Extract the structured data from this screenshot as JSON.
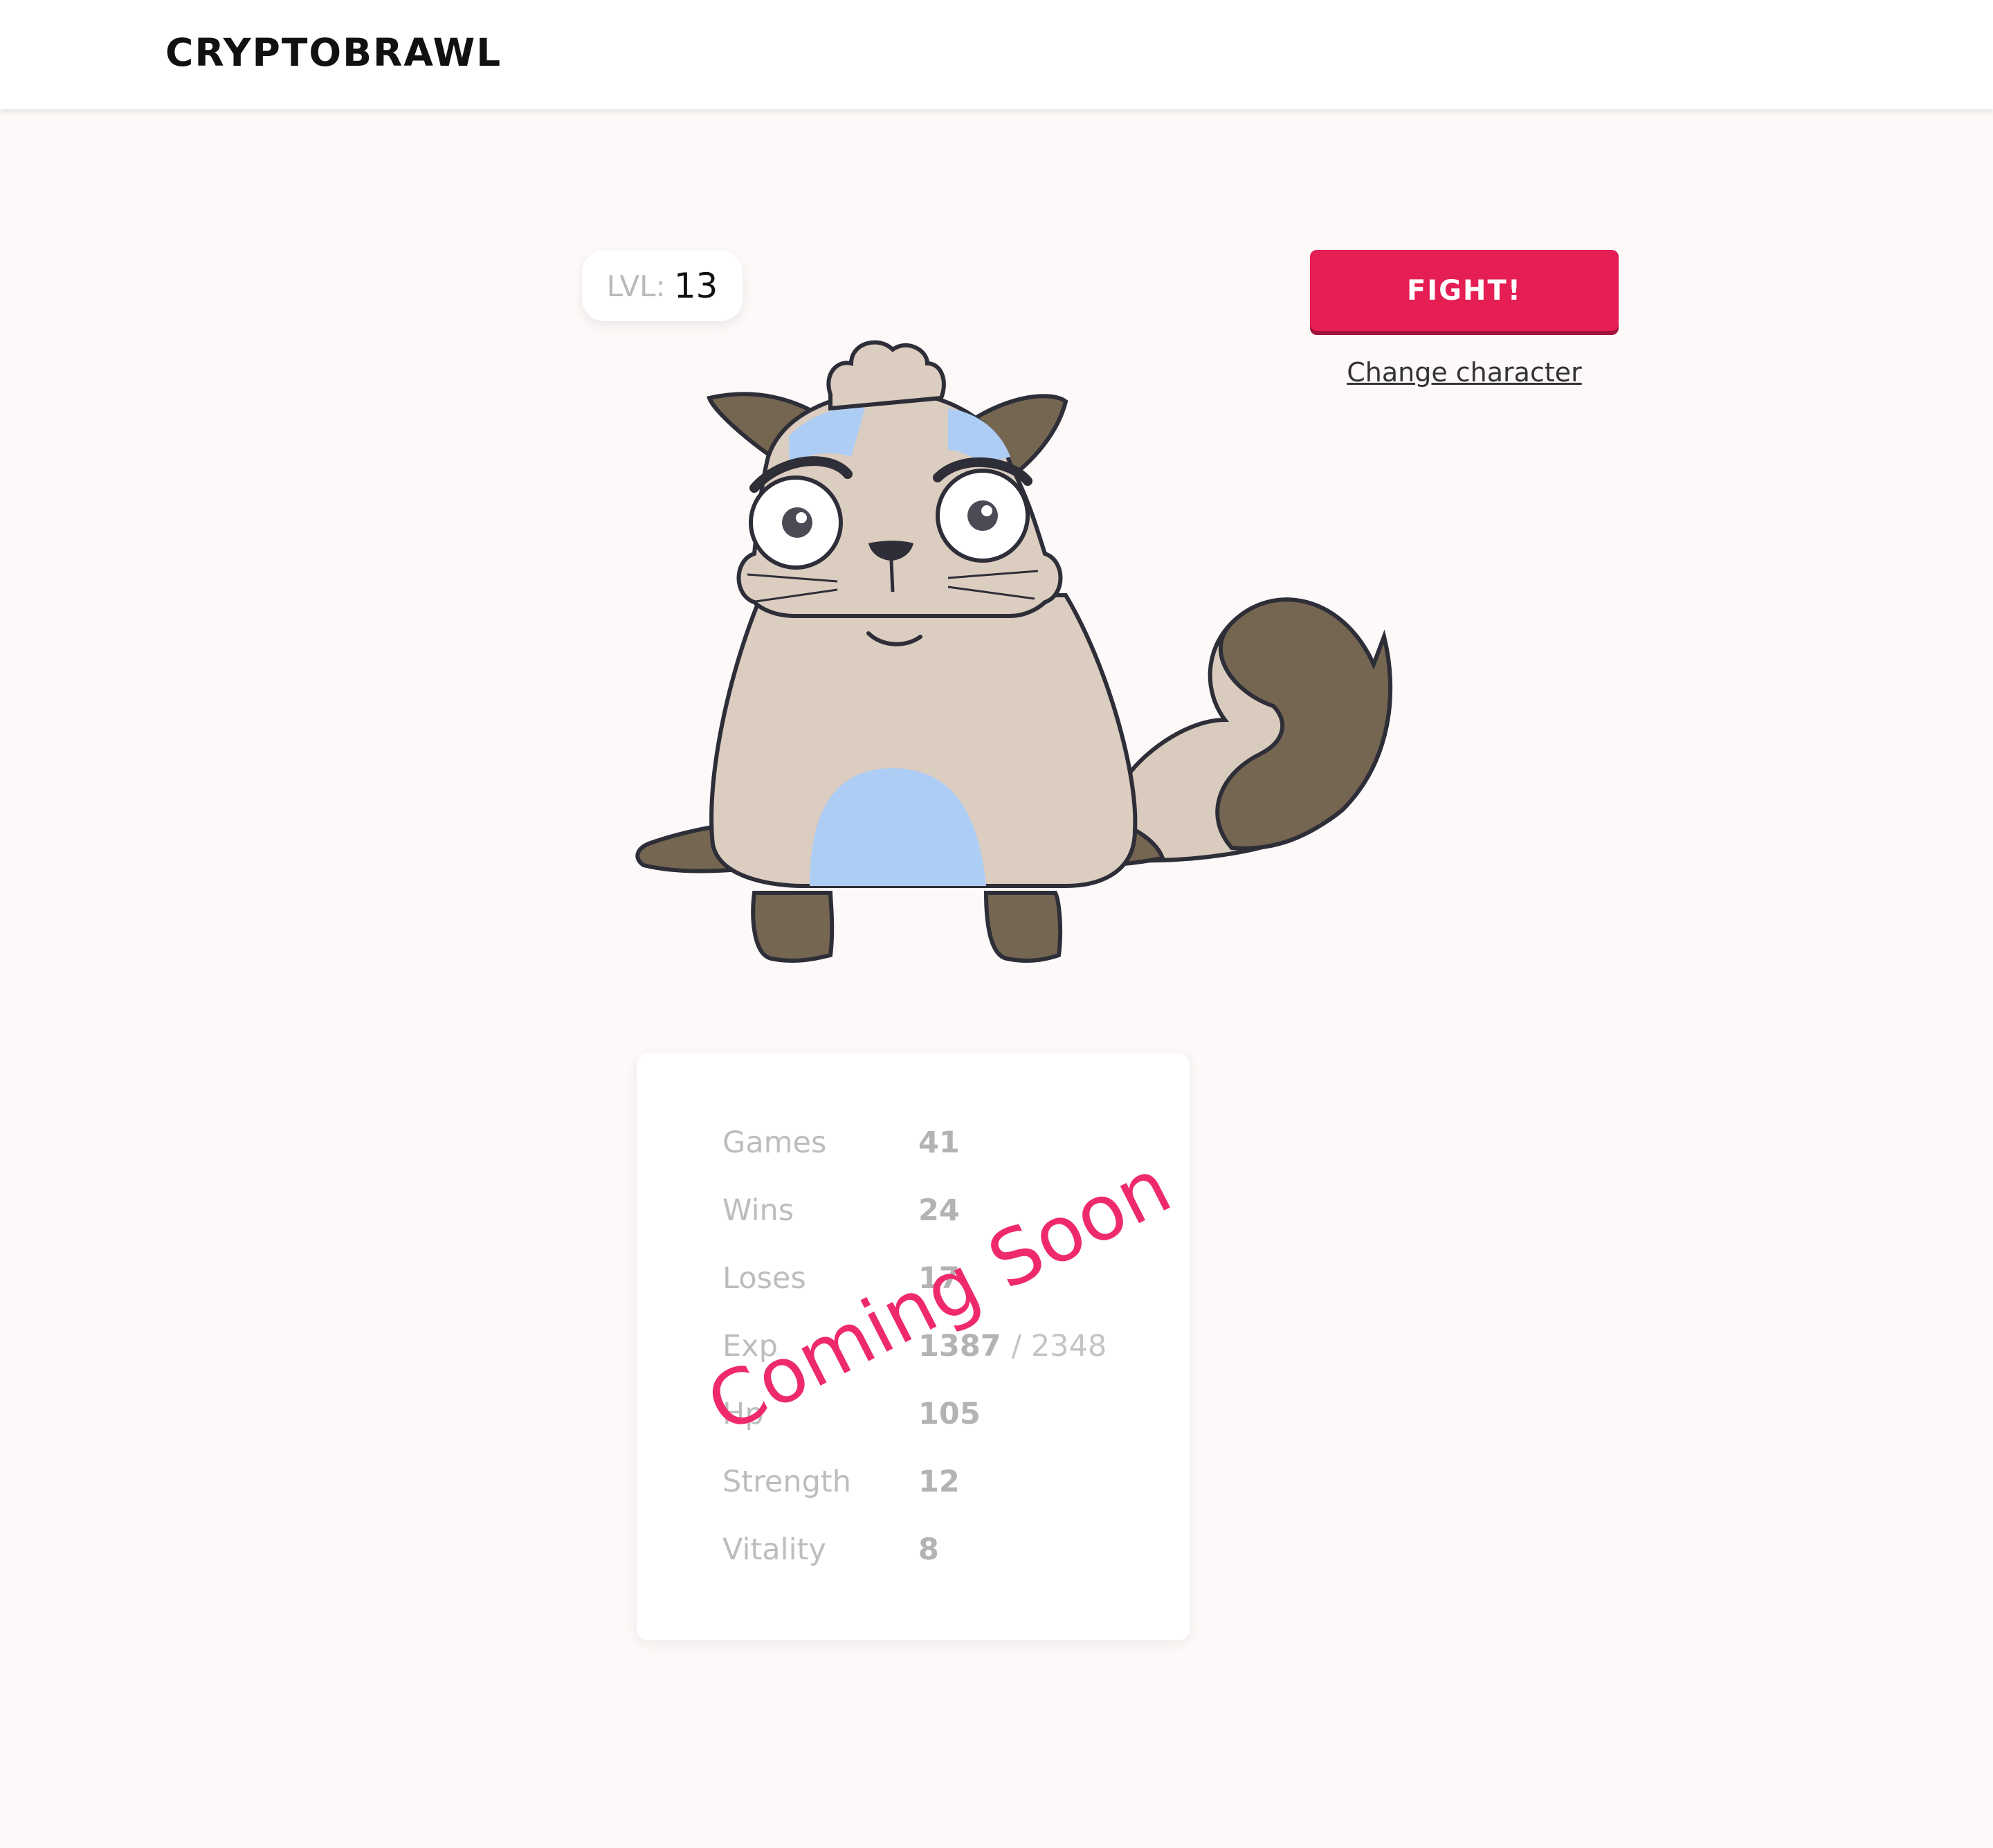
{
  "header": {
    "logo": "CRYPTOBRAWL"
  },
  "character": {
    "level_label": "LVL:",
    "level": "13",
    "fight_label": "FIGHT!",
    "change_label": "Change character"
  },
  "stats": {
    "rows": [
      {
        "label": "Games",
        "value": "41"
      },
      {
        "label": "Wins",
        "value": "24"
      },
      {
        "label": "Loses",
        "value": "17"
      },
      {
        "label": "Exp",
        "value": "1387",
        "total": "/ 2348"
      },
      {
        "label": "Hp",
        "value": "105"
      },
      {
        "label": "Strength",
        "value": "12"
      },
      {
        "label": "Vitality",
        "value": "8"
      }
    ],
    "overlay": "Coming Soon"
  },
  "colors": {
    "accent": "#e51e54",
    "overlay": "#ee2a6d",
    "background": "#fdf9f8"
  }
}
